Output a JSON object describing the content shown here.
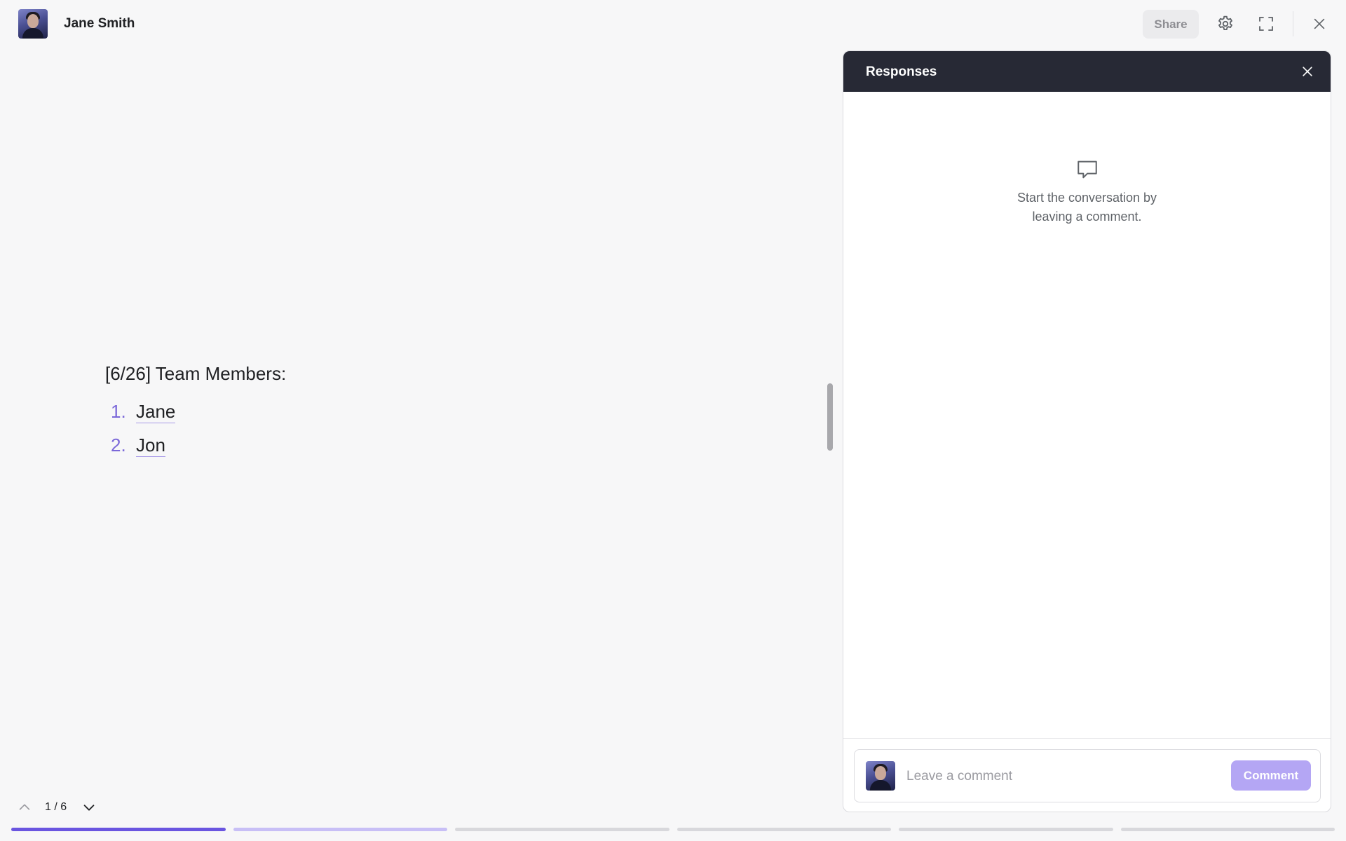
{
  "header": {
    "user_name": "Jane Smith",
    "share_label": "Share",
    "icons": [
      "avatar",
      "gear-icon",
      "expand-icon",
      "close-icon"
    ]
  },
  "document": {
    "title": "[6/26] Team Members:",
    "members": [
      {
        "number": "1.",
        "name": "Jane"
      },
      {
        "number": "2.",
        "name": "Jon"
      }
    ]
  },
  "panel": {
    "title": "Responses",
    "empty_message": "Start the conversation by leaving a comment.",
    "comment_placeholder": "Leave a comment",
    "comment_button": "Comment"
  },
  "navigation": {
    "page_counter": "1 / 6",
    "current_page": 1,
    "total_pages": 6,
    "segments": [
      {
        "state": "active",
        "fill": 1.0
      },
      {
        "state": "visited",
        "fill": 1.0
      },
      {
        "state": "pending",
        "fill": 1.0
      },
      {
        "state": "pending",
        "fill": 1.0
      },
      {
        "state": "pending",
        "fill": 1.0
      },
      {
        "state": "pending",
        "fill": 1.0
      }
    ]
  },
  "colors": {
    "accent": "#7b68d9",
    "progress_active": "#6a55e0",
    "progress_visited": "#c8bff6",
    "progress_pending": "#d8d8dc",
    "panel_header": "#272935",
    "comment_button": "#b4a6f4"
  }
}
